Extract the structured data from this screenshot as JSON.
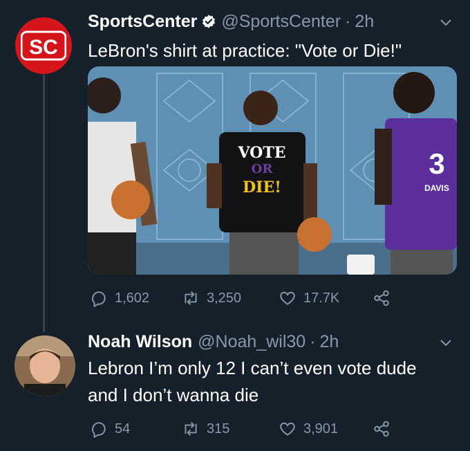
{
  "tweets": [
    {
      "name": "SportsCenter",
      "verified": true,
      "handle": "@SportsCenter",
      "separator": "·",
      "time": "2h",
      "text": "LeBron's shirt at practice: \"Vote or Die!\"",
      "avatar_logo": "SC",
      "media": {
        "shirt_text": [
          "VOTE",
          "OR",
          "DIE!"
        ],
        "jersey_number": "3",
        "jersey_name": "DAVIS"
      },
      "actions": {
        "replies": "1,602",
        "retweets": "3,250",
        "likes": "17.7K"
      }
    },
    {
      "name": "Noah Wilson",
      "verified": false,
      "handle": "@Noah_wil30",
      "separator": "·",
      "time": "2h",
      "text_lines": [
        "Lebron I’m only 12 I can’t even vote dude",
        "and I don’t wanna die"
      ],
      "actions": {
        "replies": "54",
        "retweets": "315",
        "likes": "3,901"
      }
    }
  ],
  "icons": [
    "reply-icon",
    "retweet-icon",
    "like-icon",
    "share-icon",
    "verified-badge-icon",
    "chevron-down-icon"
  ],
  "colors": {
    "background": "#15202b",
    "secondary_text": "#8899a6",
    "verified": "#ffffff",
    "logo_red": "#d4161c"
  }
}
